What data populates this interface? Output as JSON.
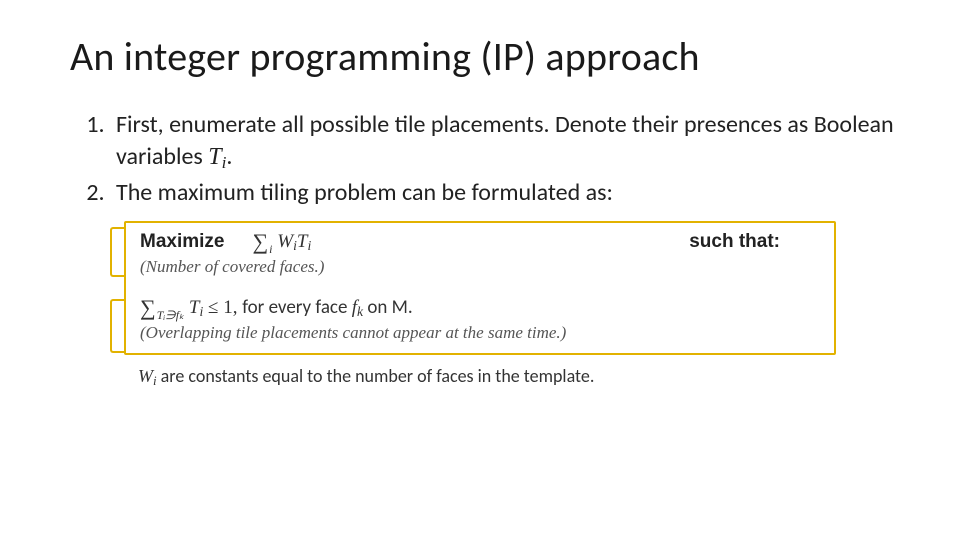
{
  "title": "An integer programming (IP) approach",
  "list": {
    "item1_a": "First, enumerate all possible tile placements. Denote their presences as Boolean variables ",
    "item1_var": "T",
    "item1_sub": "i",
    "item1_b": ".",
    "item2": "The maximum tiling problem can be formulated as:"
  },
  "panel": {
    "maximize": "Maximize",
    "sum_sub": "i",
    "W": "W",
    "W_sub": "i",
    "T": "T",
    "T_sub": "i",
    "such_that": "such that:",
    "note1": "(Number of covered faces.)",
    "constraint_sum_sub": "Tᵢ∋fₖ",
    "constraint_T": "T",
    "constraint_T_sub": "i",
    "le1": " ≤ 1, ",
    "for_every": "for every face ",
    "f": "f",
    "f_sub": "k",
    "on_M": " on M.",
    "note2": "(Overlapping tile placements cannot appear at the same time.)"
  },
  "footnote": {
    "W": "W",
    "W_sub": "i",
    "text": " are constants equal to the number of faces in the template."
  }
}
